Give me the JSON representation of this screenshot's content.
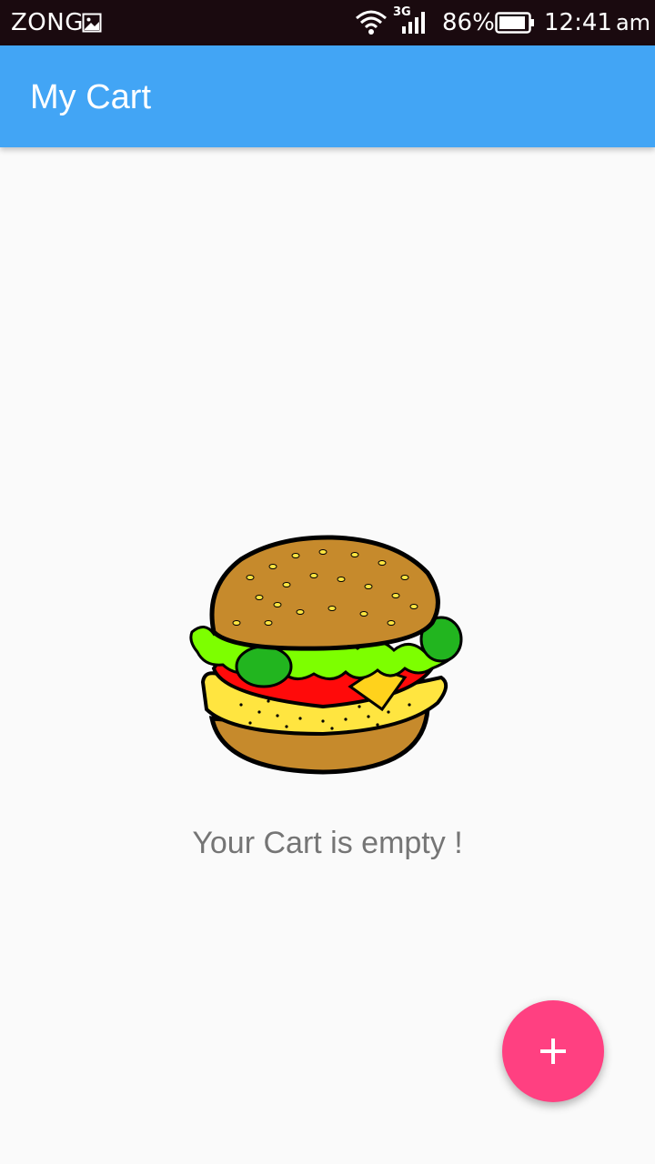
{
  "status_bar": {
    "carrier": "ZONG",
    "network_type": "3G",
    "battery_percent": "86%",
    "time": "12:41",
    "ampm": "am",
    "icons": [
      "gallery-icon",
      "wifi-icon",
      "signal-icon",
      "battery-icon"
    ]
  },
  "app_bar": {
    "title": "My Cart",
    "color": "#42a5f5"
  },
  "empty_state": {
    "image": "burger-illustration",
    "message": "Your Cart is empty !"
  },
  "fab": {
    "icon": "plus-icon",
    "color": "#ff4081"
  }
}
